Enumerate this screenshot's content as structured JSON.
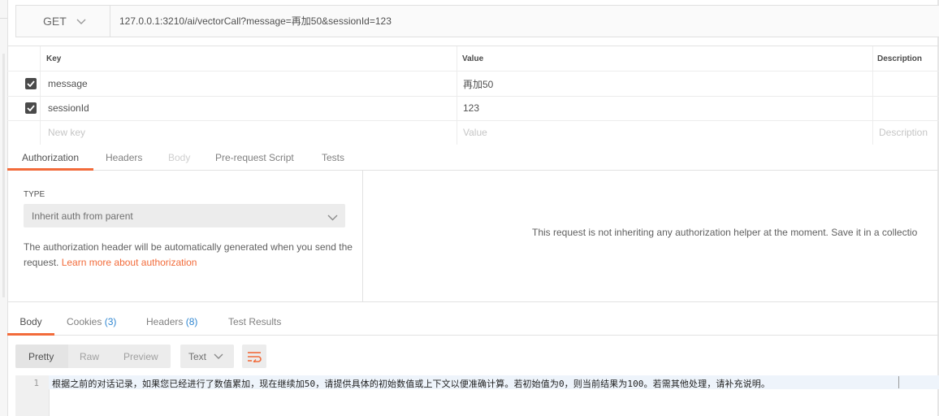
{
  "request": {
    "method": "GET",
    "url": "127.0.0.1:3210/ai/vectorCall?message=再加50&sessionId=123"
  },
  "params": {
    "headers": {
      "key": "Key",
      "value": "Value",
      "description": "Description"
    },
    "rows": [
      {
        "checked": true,
        "key": "message",
        "value": "再加50"
      },
      {
        "checked": true,
        "key": "sessionId",
        "value": "123"
      }
    ],
    "placeholder": {
      "key": "New key",
      "value": "Value",
      "description": "Description"
    }
  },
  "request_tabs": [
    "Authorization",
    "Headers",
    "Body",
    "Pre-request Script",
    "Tests"
  ],
  "auth": {
    "type_label": "TYPE",
    "type_value": "Inherit auth from parent",
    "description": "The authorization header will be automatically generated when you send the request.",
    "learn_more": "Learn more about authorization",
    "message": "This request is not inheriting any authorization helper at the moment. Save it in a collectio"
  },
  "response_tabs": {
    "body": "Body",
    "cookies": "Cookies",
    "cookies_count": "(3)",
    "headers": "Headers",
    "headers_count": "(8)",
    "test_results": "Test Results"
  },
  "response_toolbar": {
    "formats": [
      "Pretty",
      "Raw",
      "Preview"
    ],
    "language": "Text"
  },
  "response_body": {
    "line_number": "1",
    "text": "根据之前的对话记录，如果您已经进行了数值累加，现在继续加50，请提供具体的初始数值或上下文以便准确计算。若初始值为0，则当前结果为100。若需其他处理，请补充说明。"
  },
  "colors": {
    "accent": "#f26b3a",
    "link_blue": "#2f86d1",
    "checkbox": "#4a4a4a"
  }
}
